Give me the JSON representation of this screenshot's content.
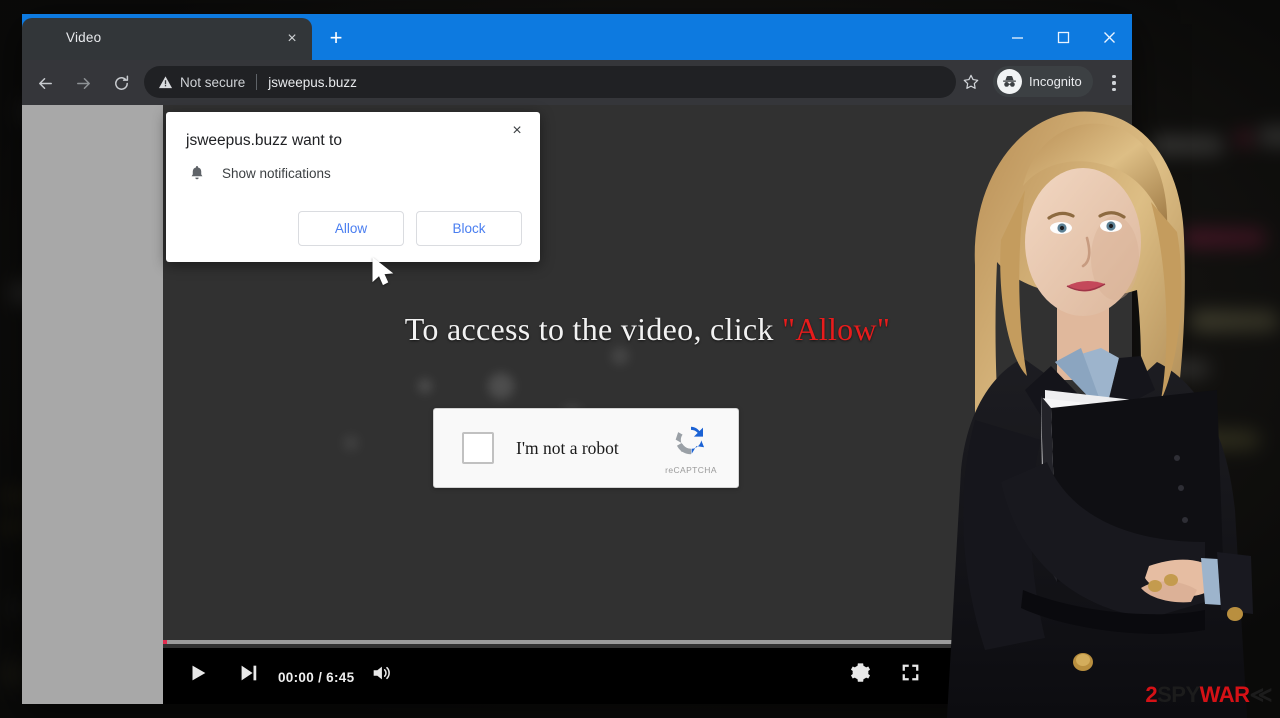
{
  "window": {
    "controls": [
      {
        "name": "minimize",
        "glyph": "minimize-icon"
      },
      {
        "name": "maximize",
        "glyph": "maximize-icon"
      },
      {
        "name": "close",
        "glyph": "close-icon"
      }
    ]
  },
  "tabs": {
    "active_title": "Video",
    "close_glyph": "×",
    "new_tab_glyph": "+"
  },
  "toolbar": {
    "back_icon": "back-arrow-icon",
    "forward_icon": "forward-arrow-icon",
    "reload_icon": "reload-icon",
    "security_label": "Not secure",
    "url": "jsweepus.buzz",
    "bookmark_icon": "star-icon",
    "profile_label": "Incognito",
    "menu_icon": "kebab-menu-icon"
  },
  "permission_dialog": {
    "title": "jsweepus.buzz want to",
    "permission_icon": "bell-icon",
    "permission_text": "Show notifications",
    "allow_label": "Allow",
    "block_label": "Block",
    "close_glyph": "×"
  },
  "page": {
    "headline_prefix": "To access to the video, click ",
    "headline_accent": "\"Allow\"",
    "captcha": {
      "label": "I'm not a robot",
      "brand": "reCAPTCHA",
      "checkbox_checked": false
    }
  },
  "player": {
    "play_icon": "play-icon",
    "next_icon": "next-track-icon",
    "time": "00:00 / 6:45",
    "volume_icon": "volume-icon",
    "settings_icon": "gear-icon",
    "fullscreen_icon": "fullscreen-icon",
    "progress_percent": 0
  },
  "watermark": {
    "part1": "2",
    "part2": "SPY",
    "part3": "WAR",
    "part4": "≪"
  },
  "colors": {
    "titlebar_blue": "#0d7ae0",
    "chrome_dark": "#202124",
    "toolbar_dark": "#35363a",
    "accent_link": "#4a7ef0",
    "danger_red": "#e81c1c",
    "page_gray": "#a8a8a8",
    "video_dark": "#313131"
  }
}
